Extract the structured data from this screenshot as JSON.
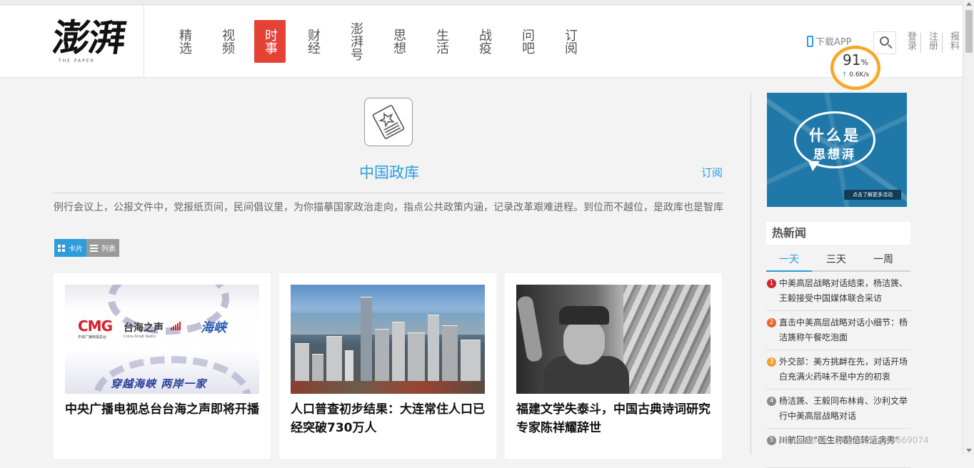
{
  "header": {
    "logo_text": "澎湃",
    "logo_sub": "THE PAPER",
    "nav": [
      {
        "label": "精选",
        "active": false
      },
      {
        "label": "视频",
        "active": false
      },
      {
        "label": "时事",
        "active": true
      },
      {
        "label": "财经",
        "active": false
      },
      {
        "label": "澎湃号",
        "active": false
      },
      {
        "label": "思想",
        "active": false
      },
      {
        "label": "生活",
        "active": false
      },
      {
        "label": "战疫",
        "active": false
      },
      {
        "label": "问吧",
        "active": false
      },
      {
        "label": "订阅",
        "active": false
      }
    ],
    "download_app": "下载APP",
    "login": "登录",
    "register": "注册",
    "report": "报料"
  },
  "speed_widget": {
    "percent": "91",
    "percent_sign": "%",
    "rate": "0.6K/s"
  },
  "topic": {
    "title": "中国政库",
    "subscribe": "订阅",
    "description": "例行会议上，公报文件中，党报纸页间，民间倡议里，为你描摹国家政治走向，指点公共政策内涵，记录改革艰难进程。到位而不越位，是政库也是智库"
  },
  "view_toggle": {
    "card": "卡片",
    "list": "列表"
  },
  "cards": [
    {
      "title": "中央广播电视总台台海之声即将开播",
      "image": {
        "cmg": "CMG",
        "cmg_sub": "中央广播电视总台",
        "twz": "台海之声",
        "twz_sub": "Cross-Strait Radio",
        "script": "海峡",
        "slogan": "穿越海峡 两岸一家"
      }
    },
    {
      "title": "人口普查初步结果：大连常住人口已经突破730万人"
    },
    {
      "title": "福建文学失泰斗，中国古典诗词研究专家陈祥耀辞世"
    }
  ],
  "sidebar": {
    "ad": {
      "line1": "什么是",
      "line2": "思想湃",
      "button": "点击了解更多活动"
    },
    "hot_title": "热新闻",
    "tabs": [
      "一天",
      "三天",
      "一周"
    ],
    "items": [
      {
        "num": "1",
        "color": "#d0232b",
        "text": "中美高层战略对话结束，杨洁篪、王毅接受中国媒体联合采访"
      },
      {
        "num": "2",
        "color": "#e8642b",
        "text": "直击中美高层战略对话小细节：杨洁篪称午餐吃泡面"
      },
      {
        "num": "3",
        "color": "#f0a030",
        "text": "外交部：美方挑衅在先，对话开场白充满火药味不是中方的初衷"
      },
      {
        "num": "4",
        "color": "#888888",
        "text": "杨洁篪、王毅同布林肯、沙利文举行中美高层战略对话"
      },
      {
        "num": "5",
        "color": "#888888",
        "text": "川航回应“医生称翻倍转运病男”"
      }
    ]
  },
  "watermark": "https://blog.csdn.net/qq_43669074",
  "colors": {
    "accent": "#2d9cdb",
    "active_nav": "#e34234"
  }
}
